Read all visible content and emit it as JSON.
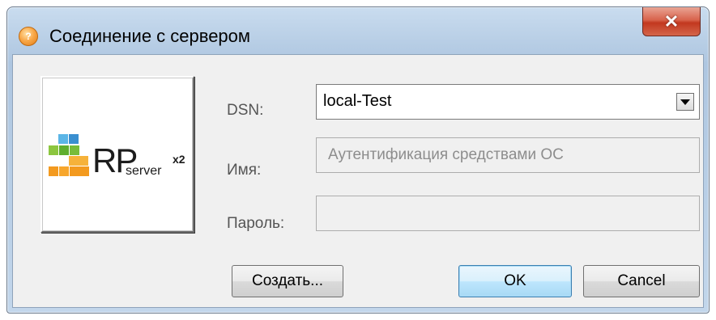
{
  "window": {
    "title": "Соединение с сервером"
  },
  "logo": {
    "rp": "RP",
    "server": "server",
    "x2": "x2"
  },
  "form": {
    "dsn_label": "DSN:",
    "dsn_value": "local-Test",
    "name_label": "Имя:",
    "name_placeholder": "Аутентификация средствами ОС",
    "password_label": "Пароль:",
    "password_value": ""
  },
  "buttons": {
    "create": "Создать...",
    "ok": "OK",
    "cancel": "Cancel"
  },
  "colors": {
    "title_gradient_top": "#c9dcef",
    "close_red": "#c2381f",
    "ok_blue": "#3c7fb1"
  }
}
